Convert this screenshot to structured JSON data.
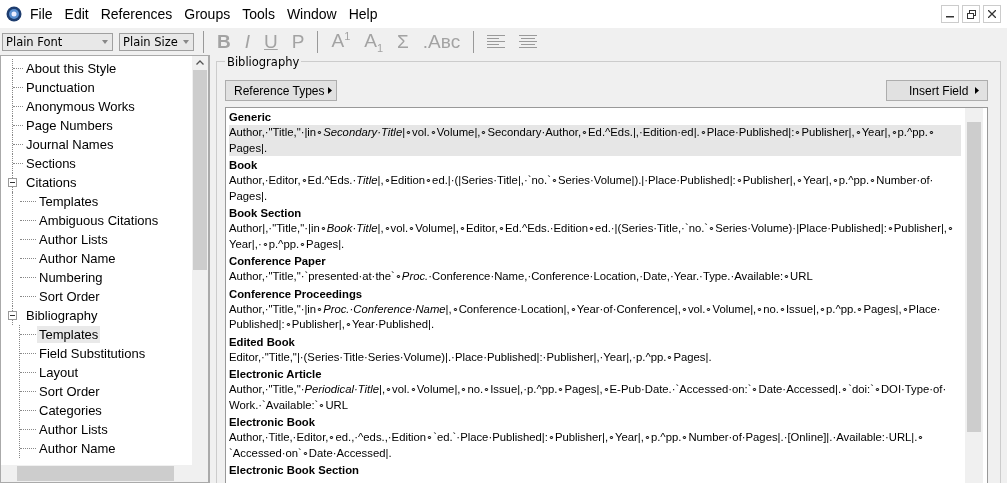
{
  "menu": [
    "File",
    "Edit",
    "References",
    "Groups",
    "Tools",
    "Window",
    "Help"
  ],
  "toolbar": {
    "font": "Plain Font",
    "size": "Plain Size",
    "buttons": [
      {
        "label": "B",
        "kind": "bold",
        "disabled": true
      },
      {
        "label": "I",
        "kind": "italic",
        "disabled": true
      },
      {
        "label": "U",
        "kind": "underline",
        "disabled": true
      },
      {
        "label": "P",
        "kind": "plain",
        "disabled": true
      },
      {
        "label": "A$^{1}$",
        "kind": "sep-text",
        "disabled": true
      },
      {
        "label": "A$_{1}$",
        "kind": "text",
        "disabled": true
      },
      {
        "label": "Σ",
        "kind": "text",
        "disabled": true
      },
      {
        "label": ".Aʙᴄ",
        "kind": "text",
        "disabled": true
      },
      {
        "kind": "align-left",
        "disabled": true
      },
      {
        "kind": "align-justify",
        "disabled": true
      }
    ]
  },
  "tree": [
    {
      "label": "About this Style",
      "selected": false
    },
    {
      "label": "Punctuation",
      "selected": false
    },
    {
      "label": "Anonymous Works",
      "selected": false
    },
    {
      "label": "Page Numbers",
      "selected": false
    },
    {
      "label": "Journal Names",
      "selected": false
    },
    {
      "label": "Sections",
      "selected": false
    },
    {
      "label": "Citations",
      "selected": false,
      "expanded": true,
      "children": [
        {
          "label": "Templates",
          "selected": false
        },
        {
          "label": "Ambiguous Citations",
          "selected": false
        },
        {
          "label": "Author Lists",
          "selected": false
        },
        {
          "label": "Author Name",
          "selected": false
        },
        {
          "label": "Numbering",
          "selected": false
        },
        {
          "label": "Sort Order",
          "selected": false
        }
      ]
    },
    {
      "label": "Bibliography",
      "selected": false,
      "expanded": true,
      "children": [
        {
          "label": "Templates",
          "selected": true
        },
        {
          "label": "Field Substitutions",
          "selected": false
        },
        {
          "label": "Layout",
          "selected": false
        },
        {
          "label": "Sort Order",
          "selected": false
        },
        {
          "label": "Categories",
          "selected": false
        },
        {
          "label": "Author Lists",
          "selected": false
        },
        {
          "label": "Author Name",
          "selected": false
        }
      ]
    }
  ],
  "panel": {
    "title": "Bibliography",
    "reference_types_button": "Reference Types",
    "insert_field_button": "Insert Field",
    "templates": [
      {
        "type": "Generic",
        "selected": true,
        "template": "Author,·\"Title,\"·|in∘*Secondary·Title*|∘vol.∘Volume|,∘Secondary·Author,∘Ed.^Eds.|,·Edition·ed|.∘Place·Published|:∘Publisher|,∘Year|,∘p.^pp.∘Pages|."
      },
      {
        "type": "Book",
        "selected": false,
        "template": "Author,·Editor,∘Ed.^Eds.·*Title*|,∘Edition∘ed.|·(|Series·Title|,·`no.`∘Series·Volume|).|·Place·Published|:∘Publisher|,∘Year|,∘p.^pp.∘Number·of·Pages|."
      },
      {
        "type": "Book Section",
        "selected": false,
        "template": "Author|,·\"Title,\"·|in∘*Book·Title*|,∘vol.∘Volume|,∘Editor,∘Ed.^Eds.·Edition∘ed.·|(Series·Title,·`no.`∘Series·Volume)·|Place·Published|:∘Publisher|,∘Year|,·∘p.^pp.∘Pages|."
      },
      {
        "type": "Conference Paper",
        "selected": false,
        "template": "Author,·\"Title,\"·`presented·at·the`∘*Proc.*·Conference·Name,·Conference·Location,·Date,·Year.·Type.·Available:∘URL"
      },
      {
        "type": "Conference Proceedings",
        "selected": false,
        "template": "Author,·\"Title,\"·|in∘*Proc.·Conference·Name*|,∘Conference·Location|,∘Year·of·Conference|,∘vol.∘Volume|,∘no.∘Issue|,∘p.^pp.∘Pages|,∘Place·Published|:∘Publisher|,∘Year·Published|."
      },
      {
        "type": "Edited Book",
        "selected": false,
        "template": "Editor,·\"Title,\"|·(Series·Title·Series·Volume)|.·Place·Published|:·Publisher|,·Year|,·p.^pp.∘Pages|."
      },
      {
        "type": "Electronic Article",
        "selected": false,
        "template": "Author,·\"Title,\"·*Periodical·Title*|,∘vol.∘Volume|,∘no.∘Issue|,·p.^pp.∘Pages|,∘E-Pub·Date.·`Accessed·on:`∘Date·Accessed|.∘`doi:`∘DOI·Type·of·Work.·`Available:`∘URL"
      },
      {
        "type": "Electronic Book",
        "selected": false,
        "template": "Author,·Title,·Editor,∘ed.,·^eds.,·Edition∘`ed.`·Place·Published|:∘Publisher|,∘Year|,∘p.^pp.∘Number·of·Pages|.·[Online]|.·Available:·URL|.∘`Accessed·on`∘Date·Accessed|."
      },
      {
        "type": "Electronic Book Section",
        "selected": false
      }
    ]
  }
}
